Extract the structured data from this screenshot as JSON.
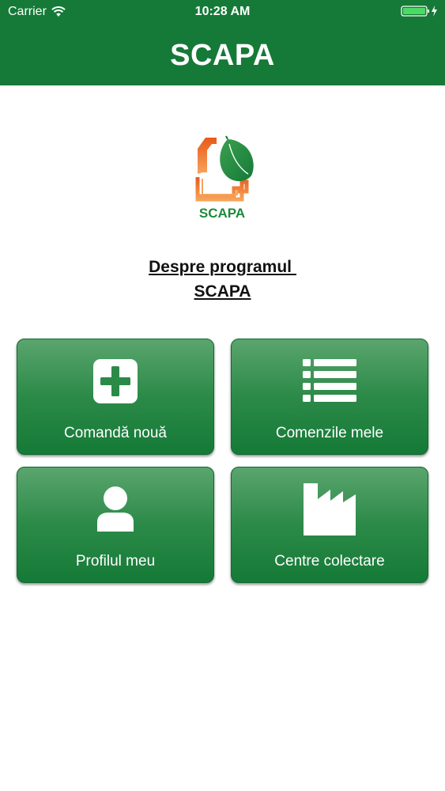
{
  "status_bar": {
    "carrier": "Carrier",
    "time": "10:28 AM",
    "wifi_icon": "wifi-icon",
    "battery_icon": "battery-charging-icon"
  },
  "nav": {
    "title": "SCAPA"
  },
  "logo": {
    "text": "SCAPA",
    "colors": {
      "orange": "#e8641e",
      "green": "#1e8a3a"
    }
  },
  "about": {
    "line1": "Despre programul ",
    "line2": "SCAPA"
  },
  "tiles": [
    {
      "label": "Comandă nouă",
      "icon": "plus-square-icon"
    },
    {
      "label": "Comenzile mele",
      "icon": "list-icon"
    },
    {
      "label": "Profilul meu",
      "icon": "user-icon"
    },
    {
      "label": "Centre colectare",
      "icon": "factory-icon"
    }
  ],
  "theme": {
    "primary": "#157a37",
    "text_dark": "#111111",
    "white": "#ffffff"
  }
}
